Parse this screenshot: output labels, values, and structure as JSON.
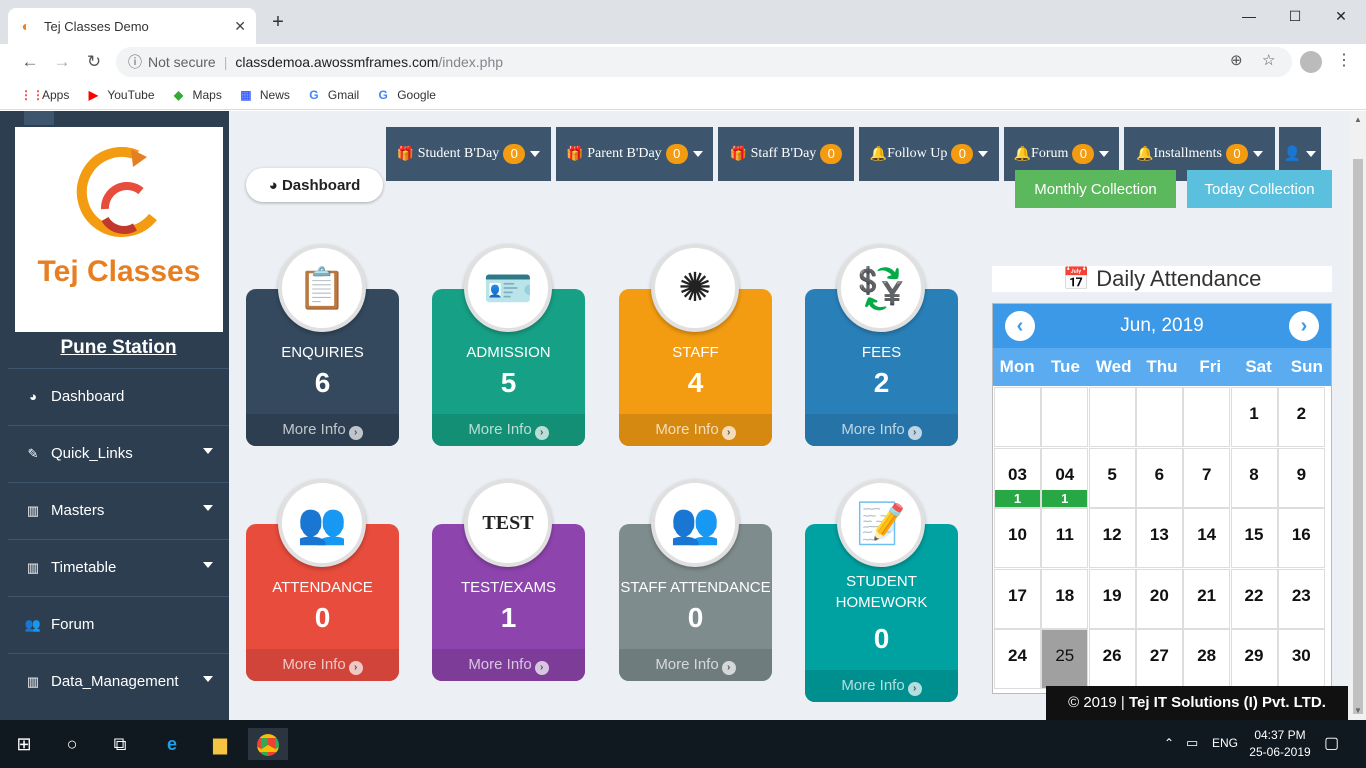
{
  "browser": {
    "tab_title": "Tej Classes Demo",
    "not_secure": "Not secure",
    "url_host": "classdemoa.awossmframes.com",
    "url_path": "/index.php",
    "bookmarks": [
      "Apps",
      "YouTube",
      "Maps",
      "News",
      "Gmail",
      "Google"
    ]
  },
  "sidebar": {
    "logo_text": "Tej Classes",
    "station": "Pune Station",
    "items": [
      {
        "label": "Dashboard",
        "icon": "dashboard-icon",
        "dropdown": false
      },
      {
        "label": "Quick_Links",
        "icon": "edit-icon",
        "dropdown": true
      },
      {
        "label": "Masters",
        "icon": "bar-chart-icon",
        "dropdown": true
      },
      {
        "label": "Timetable",
        "icon": "bar-chart-icon",
        "dropdown": true
      },
      {
        "label": "Forum",
        "icon": "users-icon",
        "dropdown": false
      },
      {
        "label": "Data_Management",
        "icon": "bar-chart-icon",
        "dropdown": true
      }
    ]
  },
  "notifications": [
    {
      "label": "Student B'Day",
      "count": "0"
    },
    {
      "label": "Parent B'Day",
      "count": "0"
    },
    {
      "label": "Staff B'Day",
      "count": "0"
    },
    {
      "label": "Follow Up",
      "count": "0"
    },
    {
      "label": "Forum",
      "count": "0"
    },
    {
      "label": "Installments",
      "count": "0"
    }
  ],
  "dashboard_label": "Dashboard",
  "collections": {
    "monthly": "Monthly Collection",
    "today": "Today Collection"
  },
  "cards": [
    {
      "label": "ENQUIRIES",
      "value": "6",
      "more": "More Info",
      "color": "#34495e",
      "more_color": "#2c3e50"
    },
    {
      "label": "ADMISSION",
      "value": "5",
      "more": "More Info",
      "color": "#16a085",
      "more_color": "#138f76"
    },
    {
      "label": "STAFF",
      "value": "4",
      "more": "More Info",
      "color": "#f39c12",
      "more_color": "#d68910"
    },
    {
      "label": "FEES",
      "value": "2",
      "more": "More Info",
      "color": "#2980b9",
      "more_color": "#2573a7"
    },
    {
      "label": "ATTENDANCE",
      "value": "0",
      "more": "More Info",
      "color": "#e74c3c",
      "more_color": "#d0443a"
    },
    {
      "label": "TEST/EXAMS",
      "value": "1",
      "more": "More Info",
      "color": "#8e44ad",
      "more_color": "#7d3c98"
    },
    {
      "label": "STAFF ATTENDANCE",
      "value": "0",
      "more": "More Info",
      "color": "#7f8c8d",
      "more_color": "#6f7c7d"
    },
    {
      "label": "STUDENT HOMEWORK",
      "value": "0",
      "more": "More Info",
      "color": "#00a1a1",
      "more_color": "#008f8f"
    }
  ],
  "test_badge": "TEST",
  "attendance": {
    "title": "Daily Attendance",
    "month": "Jun, 2019",
    "weekdays": [
      "Mon",
      "Tue",
      "Wed",
      "Thu",
      "Fri",
      "Sat",
      "Sun"
    ],
    "days": [
      [
        "",
        "",
        "",
        "",
        "",
        "1",
        "2"
      ],
      [
        "03",
        "04",
        "5",
        "6",
        "7",
        "8",
        "9"
      ],
      [
        "10",
        "11",
        "12",
        "13",
        "14",
        "15",
        "16"
      ],
      [
        "17",
        "18",
        "19",
        "20",
        "21",
        "22",
        "23"
      ],
      [
        "24",
        "25",
        "26",
        "27",
        "28",
        "29",
        "30"
      ]
    ],
    "events": {
      "03": "1",
      "04": "1"
    },
    "today": "25"
  },
  "footer": {
    "copy": "© 2019 |",
    "company": "Tej IT Solutions (I) Pvt. LTD."
  },
  "taskbar": {
    "time": "04:37 PM",
    "date": "25-06-2019",
    "lang": "ENG"
  }
}
